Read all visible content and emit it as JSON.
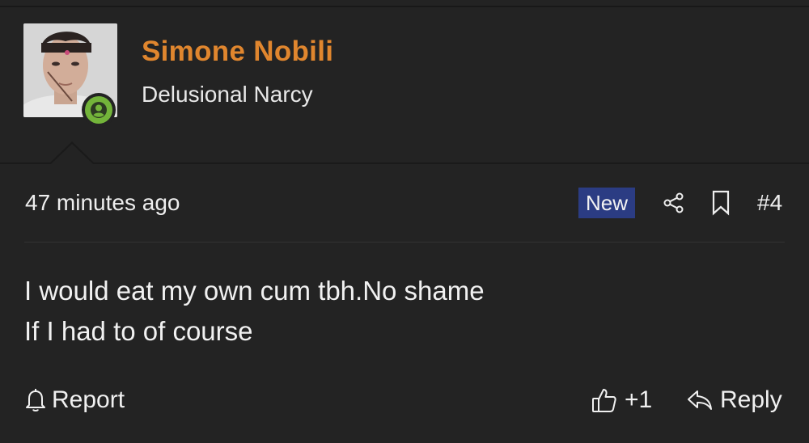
{
  "user": {
    "name": "Simone Nobili",
    "title": "Delusional Narcy",
    "status": "online"
  },
  "post": {
    "time": "47 minutes ago",
    "badge": "New",
    "number": "#4",
    "body_lines": [
      "I would eat my own cum tbh.No shame",
      "If I had to of course"
    ]
  },
  "actions": {
    "report_label": "Report",
    "reaction_count": "+1",
    "reply_label": "Reply"
  },
  "icons": {
    "share": "share-icon",
    "bookmark": "bookmark-icon",
    "report": "bell-icon",
    "like": "thumbs-up-icon",
    "reply": "reply-arrow-icon",
    "online": "user-circle-icon"
  },
  "colors": {
    "background": "#232323",
    "username": "#e0862e",
    "new_badge": "#2b3c83",
    "online": "#73b43a"
  }
}
